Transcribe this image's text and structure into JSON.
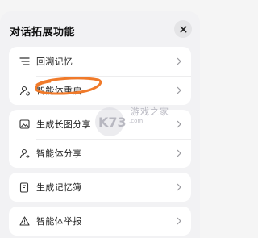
{
  "sheet": {
    "title": "对话拓展功能",
    "close_icon": "close-icon"
  },
  "menu": {
    "items": [
      {
        "id": "recall",
        "icon": "list-icon",
        "label": "回溯记忆"
      },
      {
        "id": "restart",
        "icon": "agent-restart-icon",
        "label": "智能体重启"
      },
      {
        "id": "gen-share",
        "icon": "image-icon",
        "label": "生成长图分享"
      },
      {
        "id": "agent-share",
        "icon": "agent-share-icon",
        "label": "智能体分享"
      },
      {
        "id": "memory-book",
        "icon": "book-icon",
        "label": "生成记忆簿"
      },
      {
        "id": "report",
        "icon": "warning-icon",
        "label": "智能体举报"
      }
    ]
  },
  "watermark": {
    "logo": "K73",
    "text": "游戏之家",
    "url": ".com"
  },
  "colors": {
    "background": "#f2f2f4",
    "card": "#ffffff",
    "annotation": "#f07a2a",
    "watermark": "#c6c6cf"
  }
}
